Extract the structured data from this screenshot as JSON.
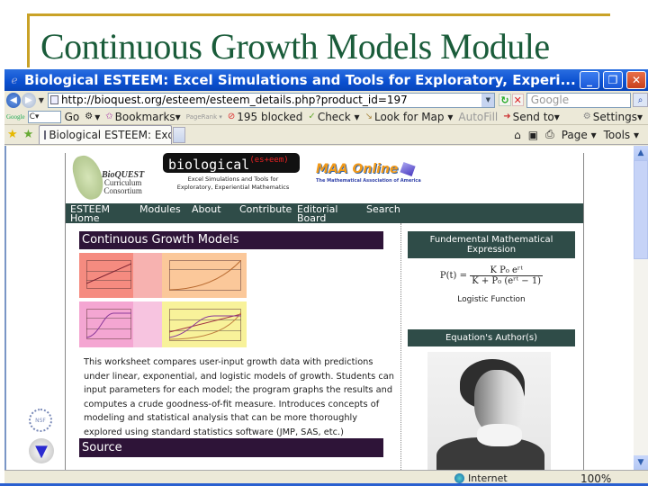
{
  "slide": {
    "title": "Continuous Growth Models Module",
    "colors": {
      "title": "#1a5c3a",
      "rule": "#c9a227"
    }
  },
  "browser": {
    "window_title": "Biological ESTEEM: Excel Simulations and Tools for Exploratory, Experi...",
    "window_controls": {
      "minimize": "_",
      "restore": "❐",
      "close": "✕"
    },
    "address": {
      "url": "http://bioquest.org/esteem/esteem_details.php?product_id=197",
      "search_placeholder": "Google",
      "back_icon": "◀",
      "forward_icon": "▶"
    },
    "google_toolbar": {
      "logo": "Google",
      "input_value": "C▾",
      "items": [
        {
          "label": "Go"
        },
        {
          "label": "▾"
        },
        {
          "label": "Bookmarks▾"
        },
        {
          "label": "PageRank ▾"
        },
        {
          "label": "195 blocked"
        },
        {
          "label": "Check ▾"
        },
        {
          "label": "Look for Map ▾"
        },
        {
          "label": "AutoFill"
        },
        {
          "label": "Send to▾"
        },
        {
          "label": "Settings▾"
        }
      ]
    },
    "tab": {
      "label": "Biological ESTEEM: Exc..."
    },
    "command_bar": {
      "home": "⌂",
      "feeds": "▣",
      "print": "⎙",
      "page": "Page ▾",
      "tools": "Tools ▾"
    },
    "status": {
      "zone": "Internet",
      "zoom": "100%"
    }
  },
  "site": {
    "bioquest": {
      "name": "BioQUEST",
      "line2": "Curriculum",
      "line3": "Consortium"
    },
    "esteem_logo": {
      "main": "biological",
      "sup": "(es+eem)",
      "subtitle_1": "Excel Simulations and Tools for",
      "subtitle_2": "Exploratory, Experiential Mathematics"
    },
    "maa": {
      "name": "MAA Online",
      "subtitle": "The Mathematical Association of America"
    },
    "nav": [
      {
        "label": "ESTEEM Home"
      },
      {
        "label": "Modules"
      },
      {
        "label": "About"
      },
      {
        "label": "Contribute"
      },
      {
        "label": "Editorial Board"
      },
      {
        "label": "Search"
      }
    ],
    "main_heading": "Continuous Growth Models",
    "thumbnail_panels": [
      "Model 1: Linear growth",
      "Model 1: Exponential growth",
      "Model 3: Logistic growth",
      "Comparison of models"
    ],
    "description": "This worksheet compares user-input growth data with predictions under linear, exponential, and logistic models of growth. Students can input parameters for each model; the program graphs the results and computes a crude goodness-of-fit measure. Introduces concepts of modeling and statistical analysis that can be more thoroughly explored using standard statistics software (JMP, SAS, etc.)",
    "source_heading": "Source",
    "side": {
      "fme_heading": "Fundemental Mathematical Expression",
      "formula_lhs": "P(t) =",
      "formula_num": "K P₀ eʳᵗ",
      "formula_den": "K + P₀ (eʳᵗ − 1)",
      "formula_caption": "Logistic Function",
      "author_heading": "Equation's Author(s)"
    },
    "left_logos": {
      "nsf": "NSF",
      "triad": "▼"
    },
    "colors": {
      "nav_bg": "#2f4c48",
      "heading_bg": "#2e1438"
    }
  }
}
